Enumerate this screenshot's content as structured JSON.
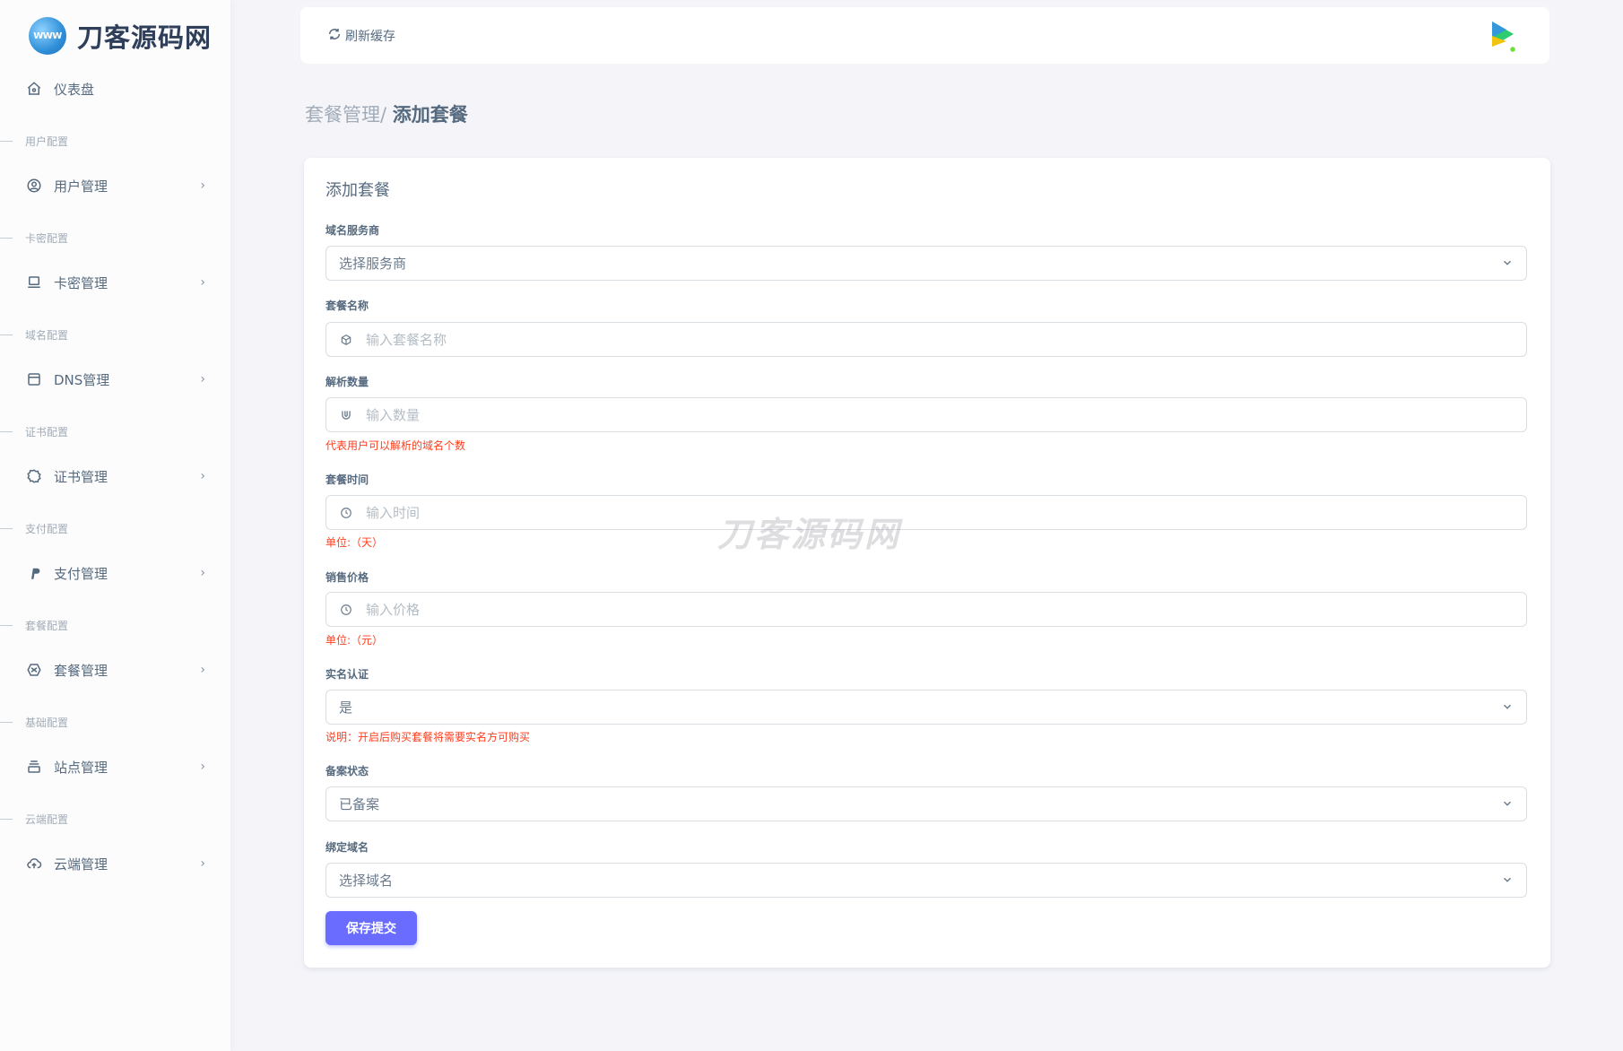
{
  "brand": {
    "logo_text": "WWW",
    "name": "刀客源码网"
  },
  "sidebar": {
    "dashboard": "仪表盘",
    "sections": [
      {
        "header": "用户配置",
        "item": "用户管理"
      },
      {
        "header": "卡密配置",
        "item": "卡密管理"
      },
      {
        "header": "域名配置",
        "item": "DNS管理"
      },
      {
        "header": "证书配置",
        "item": "证书管理"
      },
      {
        "header": "支付配置",
        "item": "支付管理"
      },
      {
        "header": "套餐配置",
        "item": "套餐管理"
      },
      {
        "header": "基础配置",
        "item": "站点管理"
      },
      {
        "header": "云端配置",
        "item": "云端管理"
      }
    ]
  },
  "navbar": {
    "refresh_label": "刷新缓存"
  },
  "breadcrumb": {
    "parent": "套餐管理/ ",
    "current": "添加套餐"
  },
  "form": {
    "title": "添加套餐",
    "provider": {
      "label": "域名服务商",
      "value": "选择服务商"
    },
    "name": {
      "label": "套餐名称",
      "placeholder": "输入套餐名称"
    },
    "count": {
      "label": "解析数量",
      "placeholder": "输入数量",
      "hint": "代表用户可以解析的域名个数"
    },
    "duration": {
      "label": "套餐时间",
      "placeholder": "输入时间",
      "hint": "单位:（天）"
    },
    "price": {
      "label": "销售价格",
      "placeholder": "输入价格",
      "hint": "单位:（元）"
    },
    "realname": {
      "label": "实名认证",
      "value": "是",
      "hint": "说明：开启后购买套餐将需要实名方可购买"
    },
    "icp": {
      "label": "备案状态",
      "value": "已备案"
    },
    "domain": {
      "label": "绑定域名",
      "value": "选择域名"
    },
    "submit": "保存提交"
  },
  "watermark": "刀客源码网",
  "colors": {
    "primary": "#696cff",
    "error": "#ff3e1d",
    "text": "#566a7f"
  }
}
